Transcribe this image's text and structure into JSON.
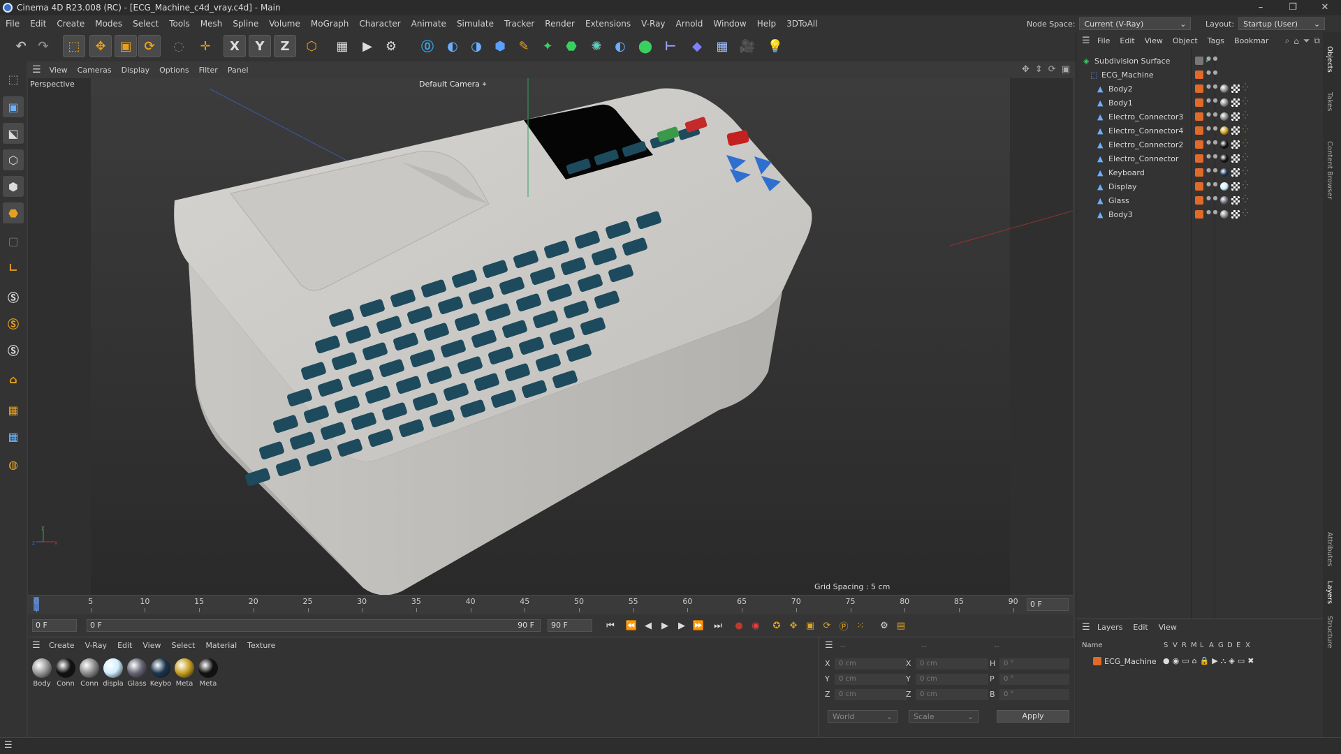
{
  "window": {
    "title": "Cinema 4D R23.008 (RC) - [ECG_Machine_c4d_vray.c4d] - Main",
    "minimize": "–",
    "maximize": "❐",
    "close": "✕"
  },
  "menu": [
    "File",
    "Edit",
    "Create",
    "Modes",
    "Select",
    "Tools",
    "Mesh",
    "Spline",
    "Volume",
    "MoGraph",
    "Character",
    "Animate",
    "Simulate",
    "Tracker",
    "Render",
    "Extensions",
    "V-Ray",
    "Arnold",
    "Window",
    "Help",
    "3DToAll"
  ],
  "node_space": {
    "label": "Node Space:",
    "value": "Current (V-Ray)"
  },
  "layout": {
    "label": "Layout:",
    "value": "Startup (User)"
  },
  "toolbar_icons": [
    "undo-icon",
    "redo-icon",
    "live-selection-icon",
    "move-icon",
    "scale-icon",
    "rotate-icon",
    "recent-tools-icon",
    "create-object-icon",
    "x-axis-icon",
    "y-axis-icon",
    "z-axis-icon",
    "world-coordinates-icon",
    "render-region-icon",
    "render-view-icon",
    "render-settings-icon",
    "vray-icon",
    "python-icon",
    "python2-icon",
    "cube-icon",
    "pen-icon",
    "cloner-icon",
    "subdivision-icon",
    "mograph-icon",
    "python3-icon",
    "deformer-icon",
    "spline-icon",
    "field-icon",
    "floor-icon",
    "camera-icon",
    "light-icon"
  ],
  "viewport": {
    "menu": [
      "View",
      "Cameras",
      "Display",
      "Options",
      "Filter",
      "Panel"
    ],
    "label": "Perspective",
    "camera": "Default Camera",
    "grid_spacing": "Grid Spacing : 5 cm"
  },
  "timeline": {
    "ticks": [
      "0",
      "5",
      "10",
      "15",
      "20",
      "25",
      "30",
      "35",
      "40",
      "45",
      "50",
      "55",
      "60",
      "65",
      "70",
      "75",
      "80",
      "85",
      "90"
    ],
    "frame_end_label": "0 F"
  },
  "transport": {
    "current": "0 F",
    "range_start": "0 F",
    "range_end": "90 F",
    "range_end2": "90 F"
  },
  "materials": {
    "menu": [
      "Create",
      "V-Ray",
      "Edit",
      "View",
      "Select",
      "Material",
      "Texture"
    ],
    "items": [
      {
        "label": "Body",
        "color": "#9a9a9a"
      },
      {
        "label": "Conn",
        "color": "#111111"
      },
      {
        "label": "Conn",
        "color": "#8e8e8e"
      },
      {
        "label": "displa",
        "color": "#cfefff"
      },
      {
        "label": "Glass",
        "color": "#666677"
      },
      {
        "label": "Keybo",
        "color": "#1b3550"
      },
      {
        "label": "Meta",
        "color": "#c8a020"
      },
      {
        "label": "Meta",
        "color": "#111111"
      }
    ]
  },
  "coords": {
    "header": [
      "--",
      "--",
      "--"
    ],
    "rows": [
      {
        "a": "X",
        "av": "0 cm",
        "b": "X",
        "bv": "0 cm",
        "c": "H",
        "cv": "0 °"
      },
      {
        "a": "Y",
        "av": "0 cm",
        "b": "Y",
        "bv": "0 cm",
        "c": "P",
        "cv": "0 °"
      },
      {
        "a": "Z",
        "av": "0 cm",
        "b": "Z",
        "bv": "0 cm",
        "c": "B",
        "cv": "0 °"
      }
    ],
    "world": "World",
    "scale": "Scale",
    "apply": "Apply"
  },
  "objects": {
    "menu": [
      "File",
      "Edit",
      "View",
      "Object",
      "Tags",
      "Bookmar"
    ],
    "items": [
      {
        "name": "Subdivision Surface",
        "level": 0
      },
      {
        "name": "ECG_Machine",
        "level": 1
      },
      {
        "name": "Body2",
        "level": 2,
        "mat": "#8a8a8a"
      },
      {
        "name": "Body1",
        "level": 2,
        "mat": "#8a8a8a"
      },
      {
        "name": "Electro_Connector3",
        "level": 2,
        "mat": "#8a8a8a"
      },
      {
        "name": "Electro_Connector4",
        "level": 2,
        "mat": "#c8a020"
      },
      {
        "name": "Electro_Connector2",
        "level": 2,
        "mat": "#111111"
      },
      {
        "name": "Electro_Connector",
        "level": 2,
        "mat": "#111111"
      },
      {
        "name": "Keyboard",
        "level": 2,
        "mat": "#1b3550"
      },
      {
        "name": "Display",
        "level": 2,
        "mat": "#cfefff"
      },
      {
        "name": "Glass",
        "level": 2,
        "mat": "#666677"
      },
      {
        "name": "Body3",
        "level": 2,
        "mat": "#8a8a8a"
      }
    ]
  },
  "layers": {
    "menu": [
      "Layers",
      "Edit",
      "View"
    ],
    "columns": [
      "Name",
      "S",
      "V",
      "R",
      "M",
      "L",
      "A",
      "G",
      "D",
      "E",
      "X"
    ],
    "item": "ECG_Machine"
  },
  "side_tabs": [
    "Objects",
    "Takes",
    "Content Browser",
    "Attributes",
    "Layers",
    "Structure"
  ]
}
